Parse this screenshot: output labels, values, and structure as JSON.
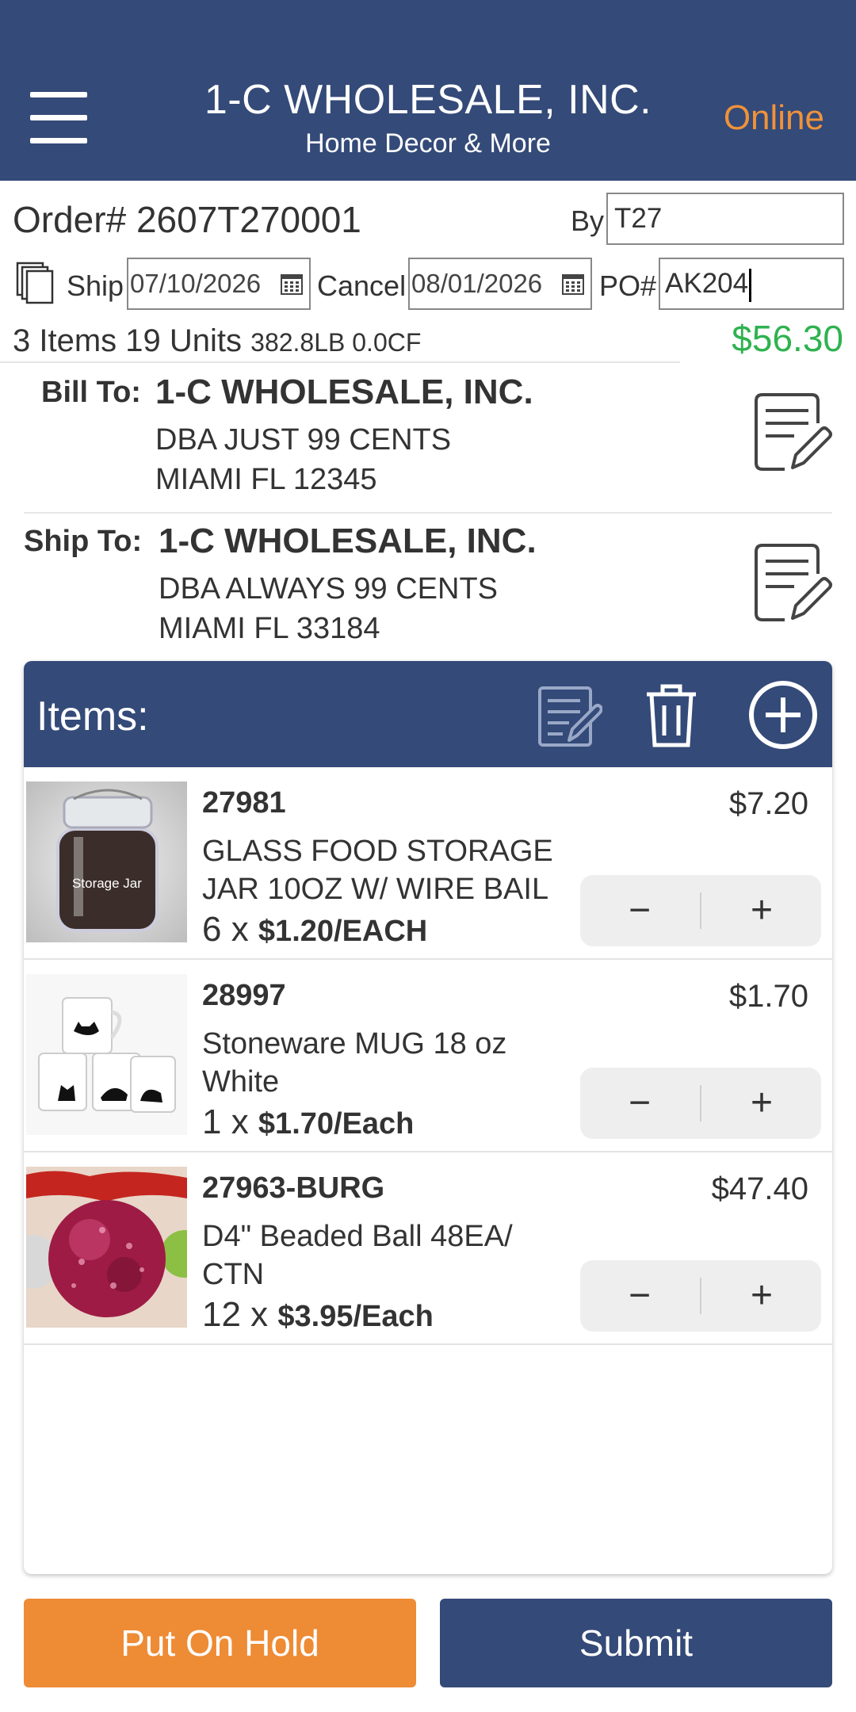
{
  "header": {
    "title": "1-C WHOLESALE, INC.",
    "subtitle": "Home Decor & More",
    "status": "Online",
    "menu_icon": "hamburger-menu-icon"
  },
  "order": {
    "order_label": "Order# 2607T270001",
    "by_label": "By",
    "by_value": "T27",
    "ship_label": "Ship",
    "ship_date": "07/10/2026",
    "cancel_label": "Cancel",
    "cancel_date": "08/01/2026",
    "po_label": "PO#",
    "po_value": "AK204",
    "summary_main": "3 Items 19 Units",
    "summary_weight": "382.8LB 0.0CF",
    "total": "$56.30"
  },
  "bill_to": {
    "label": "Bill To:",
    "name": "1-C WHOLESALE, INC.",
    "line1": "DBA JUST 99 CENTS",
    "line2": "MIAMI  FL  12345"
  },
  "ship_to": {
    "label": "Ship To:",
    "name": "1-C WHOLESALE, INC.",
    "line1": "DBA ALWAYS 99 CENTS",
    "line2": "MIAMI  FL  33184"
  },
  "items_panel": {
    "title": "Items:",
    "items": [
      {
        "sku": "27981",
        "description": "GLASS FOOD STORAGE JAR 10OZ W/ WIRE BAIL",
        "qty": "6 x ",
        "unit_price": "$1.20/EACH",
        "price": "$7.20",
        "image_label": "Storage Jar"
      },
      {
        "sku": "28997",
        "description": "Stoneware MUG 18 oz White",
        "qty": "1 x ",
        "unit_price": "$1.70/Each",
        "price": "$1.70"
      },
      {
        "sku": "27963-BURG",
        "description": "D4\" Beaded Ball 48EA/ CTN",
        "qty": "12 x ",
        "unit_price": "$3.95/Each",
        "price": "$47.40"
      }
    ],
    "minus_symbol": "−",
    "plus_symbol": "+"
  },
  "buttons": {
    "hold": "Put On Hold",
    "submit": "Submit"
  },
  "colors": {
    "brand_navy": "#344a78",
    "accent_orange": "#ee8b35",
    "total_green": "#2fb24f"
  }
}
